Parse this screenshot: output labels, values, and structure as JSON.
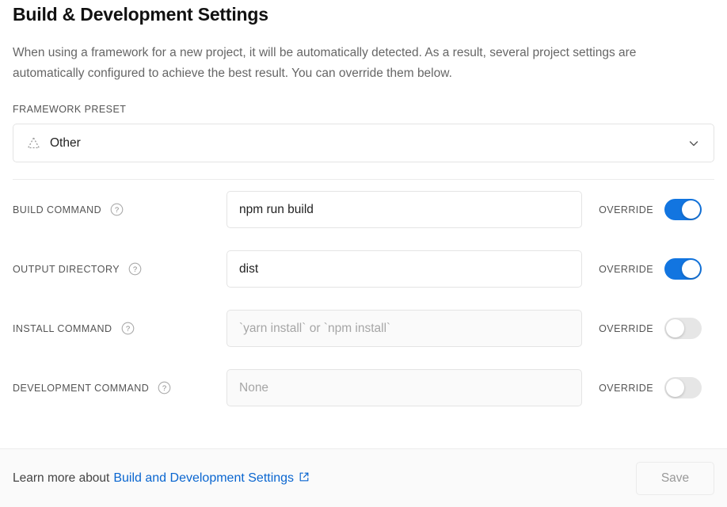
{
  "header": {
    "title": "Build & Development Settings",
    "description": "When using a framework for a new project, it will be automatically detected. As a result, several project settings are automatically configured to achieve the best result. You can override them below."
  },
  "framework_preset": {
    "label": "FRAMEWORK PRESET",
    "selected_value": "Other",
    "icon": "dashed-triangle-icon",
    "chevron_icon": "chevron-down-icon"
  },
  "rows": [
    {
      "label": "BUILD COMMAND",
      "help_icon": "question-circle-icon",
      "value": "npm run build",
      "placeholder": "",
      "override_label": "OVERRIDE",
      "override_on": true,
      "disabled": false
    },
    {
      "label": "OUTPUT DIRECTORY",
      "help_icon": "question-circle-icon",
      "value": "dist",
      "placeholder": "",
      "override_label": "OVERRIDE",
      "override_on": true,
      "disabled": false
    },
    {
      "label": "INSTALL COMMAND",
      "help_icon": "question-circle-icon",
      "value": "",
      "placeholder": "`yarn install` or `npm install`",
      "override_label": "OVERRIDE",
      "override_on": false,
      "disabled": true
    },
    {
      "label": "DEVELOPMENT COMMAND",
      "help_icon": "question-circle-icon",
      "value": "",
      "placeholder": "None",
      "override_label": "OVERRIDE",
      "override_on": false,
      "disabled": true
    }
  ],
  "footer": {
    "learn_more_text": "Learn more about",
    "link_text": "Build and Development Settings",
    "external_icon": "external-link-icon",
    "save_label": "Save"
  },
  "colors": {
    "accent_blue": "#1275e0",
    "link_blue": "#0a66d0",
    "toggle_off": "#e6e6e6",
    "border": "#e4e4e4",
    "footer_bg": "#fafafa"
  }
}
